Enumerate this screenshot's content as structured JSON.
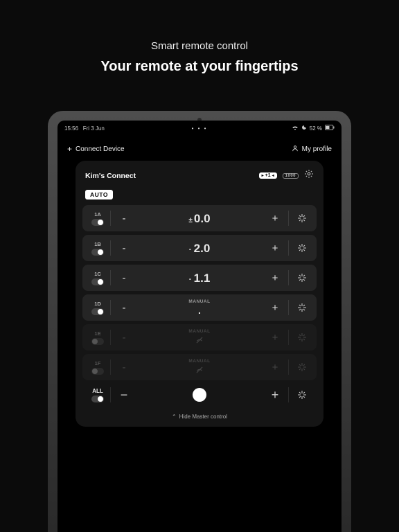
{
  "hero": {
    "subtitle": "Smart remote control",
    "title": "Your remote at your fingertips"
  },
  "status_bar": {
    "time": "15:56",
    "date": "Fri 3 Jun",
    "battery_pct": "52 %"
  },
  "topbar": {
    "connect_label": "Connect Device",
    "profile_label": "My profile"
  },
  "card": {
    "title": "Kim's Connect",
    "badge_primary": "+1",
    "badge_secondary": "1000",
    "mode": "AUTO",
    "hide_master_label": "Hide Master control"
  },
  "channels": [
    {
      "id": "1A",
      "value": "0.0",
      "prefix": "±",
      "mode": "value",
      "enabled": true,
      "toggle": "on"
    },
    {
      "id": "1B",
      "value": "2.0",
      "prefix": "·",
      "mode": "value",
      "enabled": true,
      "toggle": "on"
    },
    {
      "id": "1C",
      "value": "1.1",
      "prefix": "·",
      "mode": "value",
      "enabled": true,
      "toggle": "on"
    },
    {
      "id": "1D",
      "value": ".",
      "prefix": "",
      "mode": "manual",
      "enabled": true,
      "toggle": "on"
    },
    {
      "id": "1E",
      "value": "",
      "prefix": "",
      "mode": "nosignal",
      "enabled": false,
      "toggle": "off"
    },
    {
      "id": "1F",
      "value": "",
      "prefix": "",
      "mode": "nosignal",
      "enabled": false,
      "toggle": "off"
    }
  ],
  "master": {
    "label": "ALL",
    "toggle": "on"
  }
}
